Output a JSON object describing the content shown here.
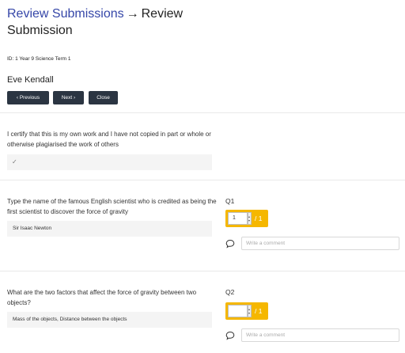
{
  "header": {
    "breadcrumb_link": "Review Submissions",
    "arrow": "→",
    "page_title": "Review Submission"
  },
  "submission": {
    "id_text": "ID: 1 Year 9 Science Term 1",
    "student_name": "Eve Kendall"
  },
  "nav": {
    "previous_label": "Previous",
    "next_label": "Next",
    "close_label": "Close"
  },
  "certification": {
    "text": "I certify that this is my own work and I have not copied in part or whole or otherwise plagiarised the work of others",
    "answer_mark": "✓"
  },
  "questions": [
    {
      "label": "Q1",
      "text": "Type the name of the famous English scientist who is credited as being the first scientist to discover the force of gravity",
      "answer": "Sir Isaac Newton",
      "score": "1",
      "max_score": "/ 1",
      "comment_placeholder": "Write a comment"
    },
    {
      "label": "Q2",
      "text": "What are the two factors that affect the force of gravity between two objects?",
      "answer": "Mass of the objects, Distance between the objects",
      "score": "",
      "max_score": "/ 1",
      "comment_placeholder": "Write a comment"
    }
  ],
  "colors": {
    "link": "#3546a8",
    "button": "#2b3542",
    "score_accent": "#f5b700"
  }
}
